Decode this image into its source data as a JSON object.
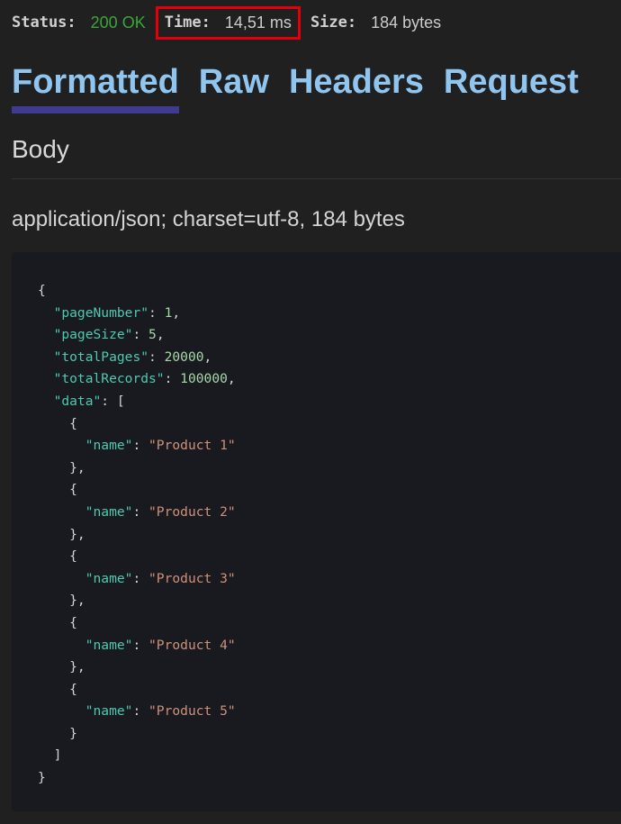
{
  "status_bar": {
    "status_label": "Status:",
    "status_value": "200 OK",
    "time_label": "Time:",
    "time_value": "14,51 ms",
    "size_label": "Size:",
    "size_value": "184 bytes"
  },
  "tabs": [
    {
      "label": "Formatted",
      "active": true
    },
    {
      "label": "Raw",
      "active": false
    },
    {
      "label": "Headers",
      "active": false
    },
    {
      "label": "Request",
      "active": false
    }
  ],
  "body": {
    "heading": "Body",
    "content_type": "application/json; charset=utf-8, 184 bytes"
  },
  "json_response": {
    "pageNumber": 1,
    "pageSize": 5,
    "totalPages": 20000,
    "totalRecords": 100000,
    "data": [
      {
        "name": "Product 1"
      },
      {
        "name": "Product 2"
      },
      {
        "name": "Product 3"
      },
      {
        "name": "Product 4"
      },
      {
        "name": "Product 5"
      }
    ]
  },
  "colors": {
    "status_ok": "#3aa63a",
    "tab_text": "#8fc5ee",
    "tab_underline": "#3f3b90",
    "highlight_border": "#e3000b",
    "json_key": "#4ec9b0",
    "json_string": "#ce9178",
    "json_number": "#a8d8a8"
  }
}
